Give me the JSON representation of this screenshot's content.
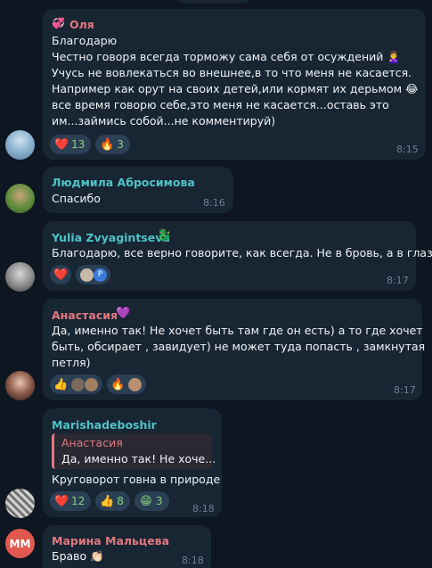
{
  "messages": [
    {
      "author": "Оля",
      "author_emoji": "💞",
      "lines": [
        "Благодарю",
        "Честно говоря всегда торможу сама себя от осуждений 🙎‍♀️",
        "Учусь не вовлекаться во внешнее,в то что меня не касается.",
        "Например как орут на своих детей,или кормят их дерьмом 😂",
        "все время говорю себе,это меня не касается...оставь это",
        "им...займись собой...не комментируй)"
      ],
      "time": "8:15",
      "reactions": [
        {
          "emoji": "❤️",
          "count": "13"
        },
        {
          "emoji": "🔥",
          "count": "3"
        }
      ]
    },
    {
      "author": "Людмила Абросимова",
      "lines": [
        "Спасибо"
      ],
      "time": "8:16"
    },
    {
      "author": "Yulia Zvyagintseva",
      "author_emoji": "🐉",
      "lines": [
        "Благодарю, все верно говорите, как всегда. Не в бровь, а в глаз!"
      ],
      "time": "8:17",
      "reactions": [
        {
          "emoji": "❤️"
        },
        {
          "badge": "P"
        }
      ]
    },
    {
      "author": "Анастасия",
      "author_emoji": "💜",
      "lines": [
        "Да, именно так! Не хочет быть там где он есть) а то где хочет",
        "быть, обсирает , завидует) не может туда попасть , замкнутая",
        "петля)"
      ],
      "time": "8:17",
      "reactions": [
        {
          "emoji": "👍"
        },
        {
          "emoji": "🔥"
        }
      ]
    },
    {
      "author": "Marishadeboshir",
      "quote": {
        "author": "Анастасия",
        "text": "Да, именно так! Не хоче..."
      },
      "lines": [
        "Круговорот говна в природе"
      ],
      "time": "8:18",
      "reactions": [
        {
          "emoji": "❤️",
          "count": "12"
        },
        {
          "emoji": "👍",
          "count": "8"
        },
        {
          "emoji": "😁",
          "count": "3"
        }
      ]
    },
    {
      "author": "Марина Мальцева",
      "avatar_initials": "ММ",
      "lines": [
        "Браво 👏🏻"
      ],
      "time": "8:18"
    }
  ],
  "colors": {
    "background": "#0e1621",
    "bubble": "#182533",
    "name_pink": "#e07880",
    "name_teal": "#4fc3c7",
    "name_blue": "#6ab3f3",
    "reaction_chip": "#2b3f55",
    "reaction_count": "#8ad27e",
    "time": "#6d7f8f"
  }
}
